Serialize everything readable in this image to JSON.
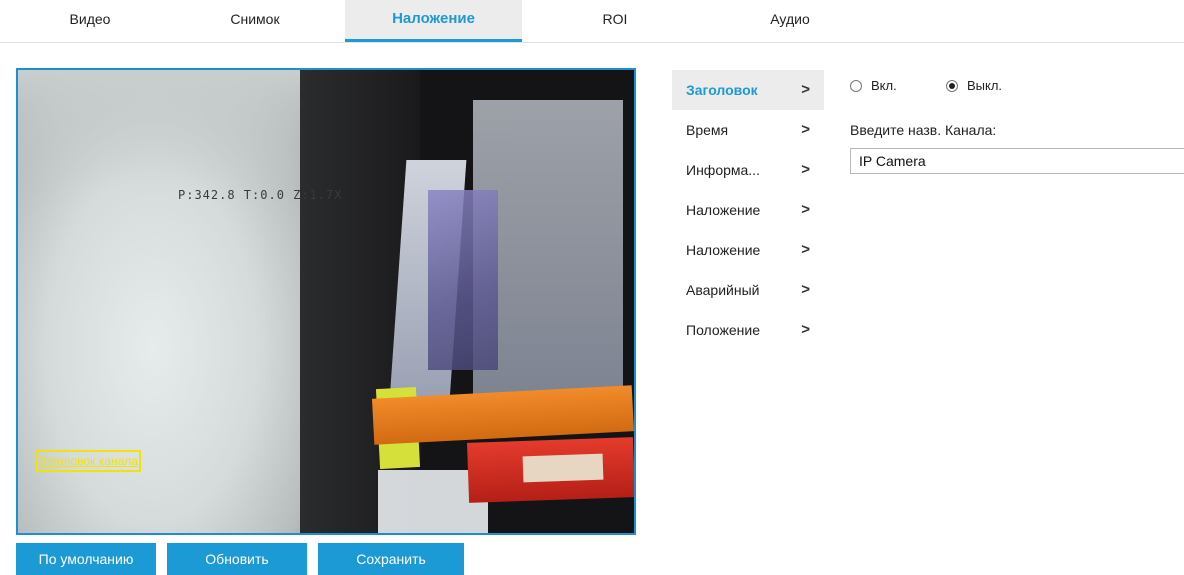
{
  "tabs": [
    {
      "label": "Видео",
      "active": false
    },
    {
      "label": "Снимок",
      "active": false
    },
    {
      "label": "Наложение",
      "active": true
    },
    {
      "label": "ROI",
      "active": false
    },
    {
      "label": "Аудио",
      "active": false
    }
  ],
  "preview": {
    "osd_ptz_text": "P:342.8 T:0.0 Z:1.7X",
    "osd_channel_title": "Заголовок канала"
  },
  "buttons": {
    "default": "По умолчанию",
    "refresh": "Обновить",
    "save": "Сохранить"
  },
  "menu": {
    "items": [
      {
        "label": "Заголовок",
        "active": true
      },
      {
        "label": "Время",
        "active": false
      },
      {
        "label": "Информа...",
        "active": false
      },
      {
        "label": "Наложение",
        "active": false
      },
      {
        "label": "Наложение",
        "active": false
      },
      {
        "label": "Аварийный",
        "active": false
      },
      {
        "label": "Положение",
        "active": false
      }
    ],
    "chevron": ">"
  },
  "settings": {
    "on_label": "Вкл.",
    "off_label": "Выкл.",
    "selected": "off",
    "channel_name_label": "Введите назв. Канала:",
    "channel_name_value": "IP Camera"
  },
  "colors": {
    "accent": "#1b9ad6",
    "osd_highlight": "#f2e10b"
  }
}
